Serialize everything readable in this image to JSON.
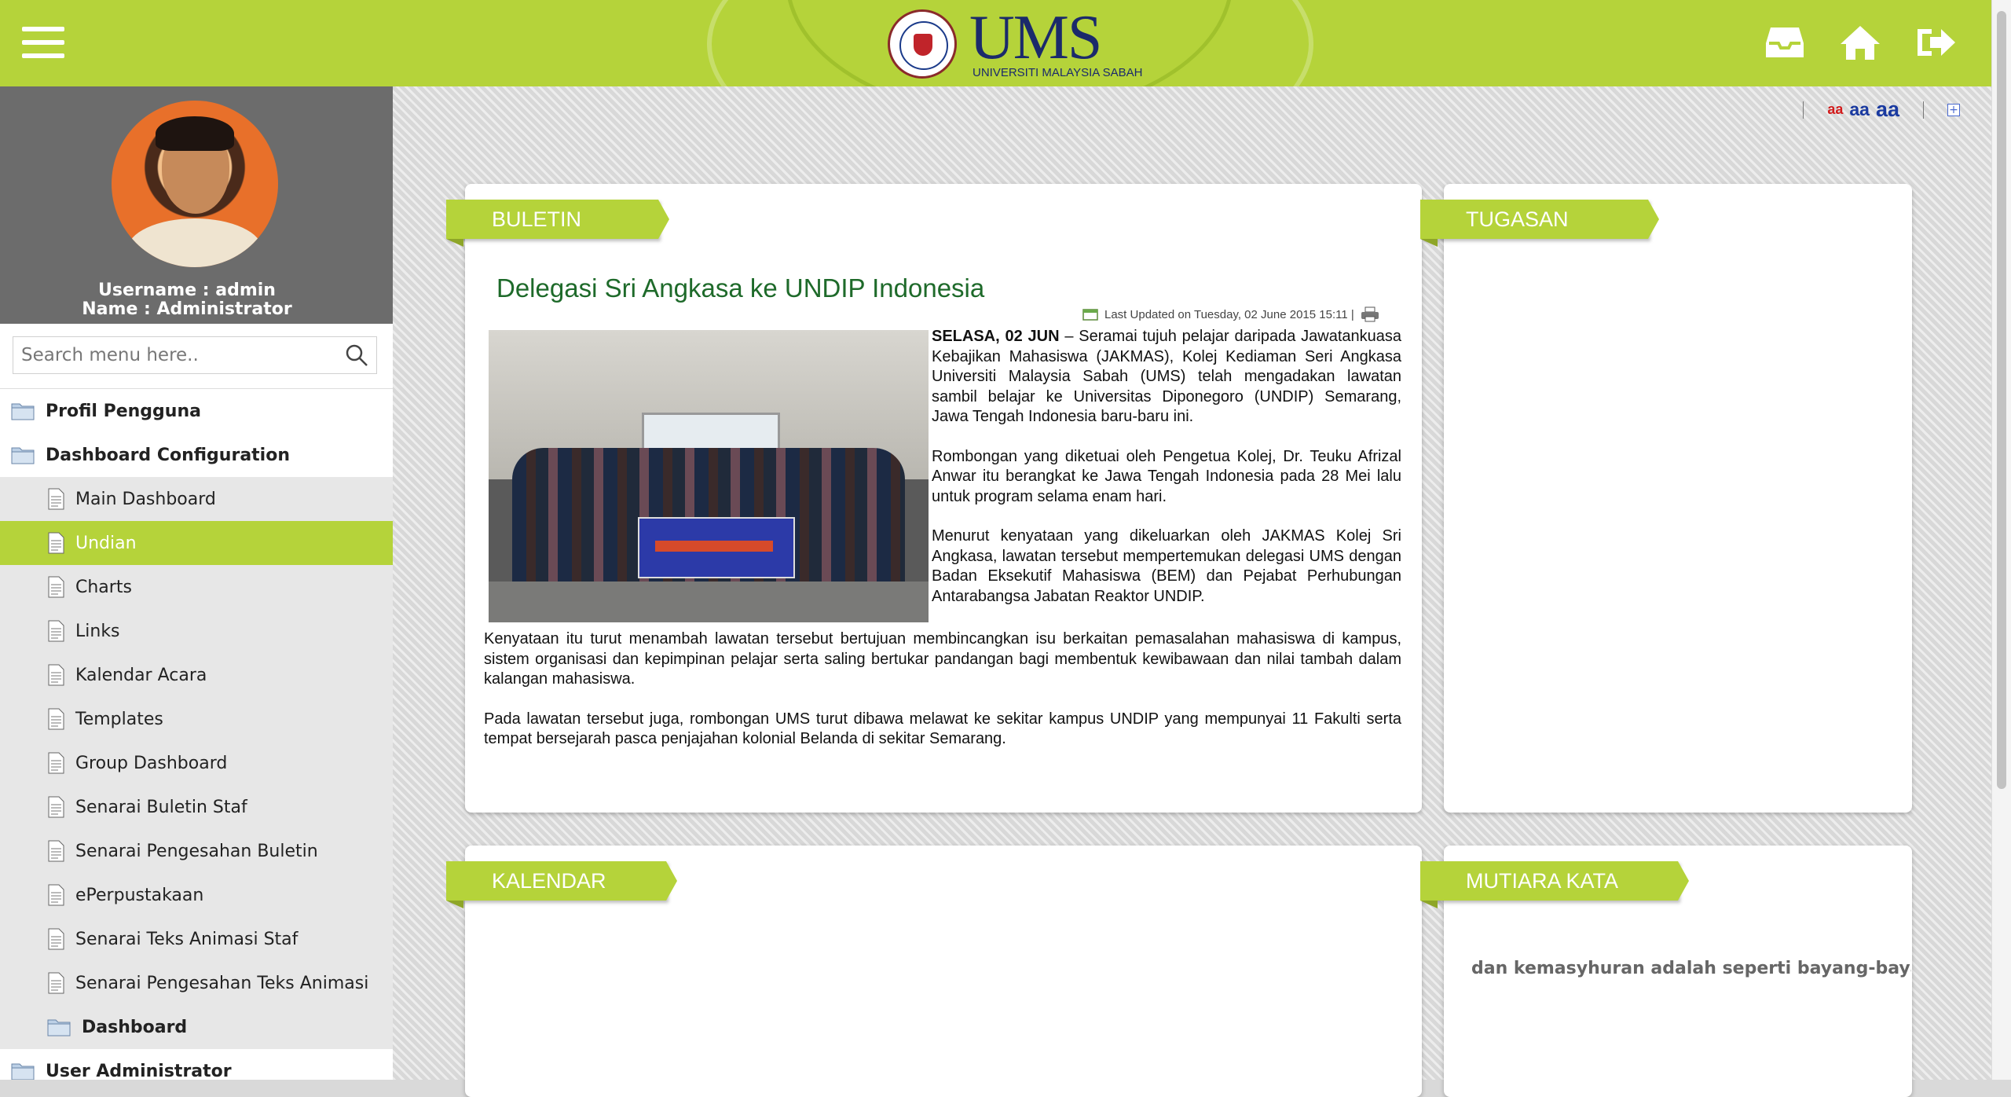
{
  "header": {
    "logo_text": "UMS",
    "logo_subtitle": "UNIVERSITI MALAYSIA SABAH",
    "icons": [
      "inbox-icon",
      "home-icon",
      "logout-icon"
    ],
    "brand_color": "#b5d33a"
  },
  "sidebar": {
    "username_line": "Username : admin",
    "name_line": "Name : Administrator",
    "search_placeholder": "Search menu here..",
    "items": [
      {
        "label": "Profil Pengguna",
        "level": 0,
        "type": "folder"
      },
      {
        "label": "Dashboard Configuration",
        "level": 0,
        "type": "folder"
      },
      {
        "label": "Main Dashboard",
        "level": 1,
        "type": "page"
      },
      {
        "label": "Undian",
        "level": 1,
        "type": "page",
        "active": true
      },
      {
        "label": "Charts",
        "level": 1,
        "type": "page"
      },
      {
        "label": "Links",
        "level": 1,
        "type": "page"
      },
      {
        "label": "Kalendar Acara",
        "level": 1,
        "type": "page"
      },
      {
        "label": "Templates",
        "level": 1,
        "type": "page"
      },
      {
        "label": "Group Dashboard",
        "level": 1,
        "type": "page"
      },
      {
        "label": "Senarai Buletin Staf",
        "level": 1,
        "type": "page"
      },
      {
        "label": "Senarai Pengesahan Buletin",
        "level": 1,
        "type": "page"
      },
      {
        "label": "ePerpustakaan",
        "level": 1,
        "type": "page"
      },
      {
        "label": "Senarai Teks Animasi Staf",
        "level": 1,
        "type": "page"
      },
      {
        "label": "Senarai Pengesahan Teks Animasi",
        "level": 1,
        "type": "page"
      },
      {
        "label": "Dashboard",
        "level": 1,
        "type": "folder"
      },
      {
        "label": "User Administrator",
        "level": 0,
        "type": "folder"
      }
    ]
  },
  "fontsize": {
    "small": "aa",
    "medium": "aa",
    "large": "aa",
    "expand": "+"
  },
  "panels": {
    "buletin": {
      "title": "BULETIN",
      "article_title": "Delegasi Sri Angkasa ke UNDIP Indonesia",
      "last_updated": "Last Updated on Tuesday, 02 June 2015 15:11 |",
      "dateline": "SELASA, 02 JUN",
      "p1_rest": " – Seramai tujuh pelajar daripada Jawatankuasa Kebajikan Mahasiswa (JAKMAS), Kolej Kediaman Seri Angkasa Universiti Malaysia Sabah (UMS) telah mengadakan lawatan sambil belajar ke Universitas Diponegoro (UNDIP) Semarang, Jawa Tengah Indonesia baru-baru ini.",
      "p2": "Rombongan yang diketuai oleh Pengetua Kolej, Dr. Teuku Afrizal Anwar itu berangkat ke Jawa Tengah Indonesia pada 28 Mei lalu untuk program selama enam hari.",
      "p3": "Menurut kenyataan yang dikeluarkan oleh JAKMAS Kolej Sri Angkasa, lawatan tersebut mempertemukan delegasi UMS dengan Badan Eksekutif Mahasiswa (BEM) dan Pejabat Perhubungan Antarabangsa Jabatan Reaktor UNDIP.",
      "p4": "Kenyataan itu turut menambah lawatan tersebut bertujuan membincangkan isu berkaitan pemasalahan mahasiswa di kampus, sistem organisasi dan kepimpinan pelajar serta saling bertukar pandangan bagi membentuk kewibawaan dan nilai tambah dalam kalangan mahasiswa.",
      "p5": "Pada lawatan tersebut juga, rombongan UMS turut dibawa melawat ke sekitar kampus UNDIP yang mempunyai 11 Fakulti serta tempat bersejarah pasca penjajahan kolonial Belanda di sekitar Semarang."
    },
    "tugasan": {
      "title": "TUGASAN"
    },
    "kalendar": {
      "title": "KALENDAR"
    },
    "mutiara": {
      "title": "MUTIARA KATA",
      "quote": "dan kemasyhuran adalah seperti bayang-bayang. Teta"
    }
  }
}
